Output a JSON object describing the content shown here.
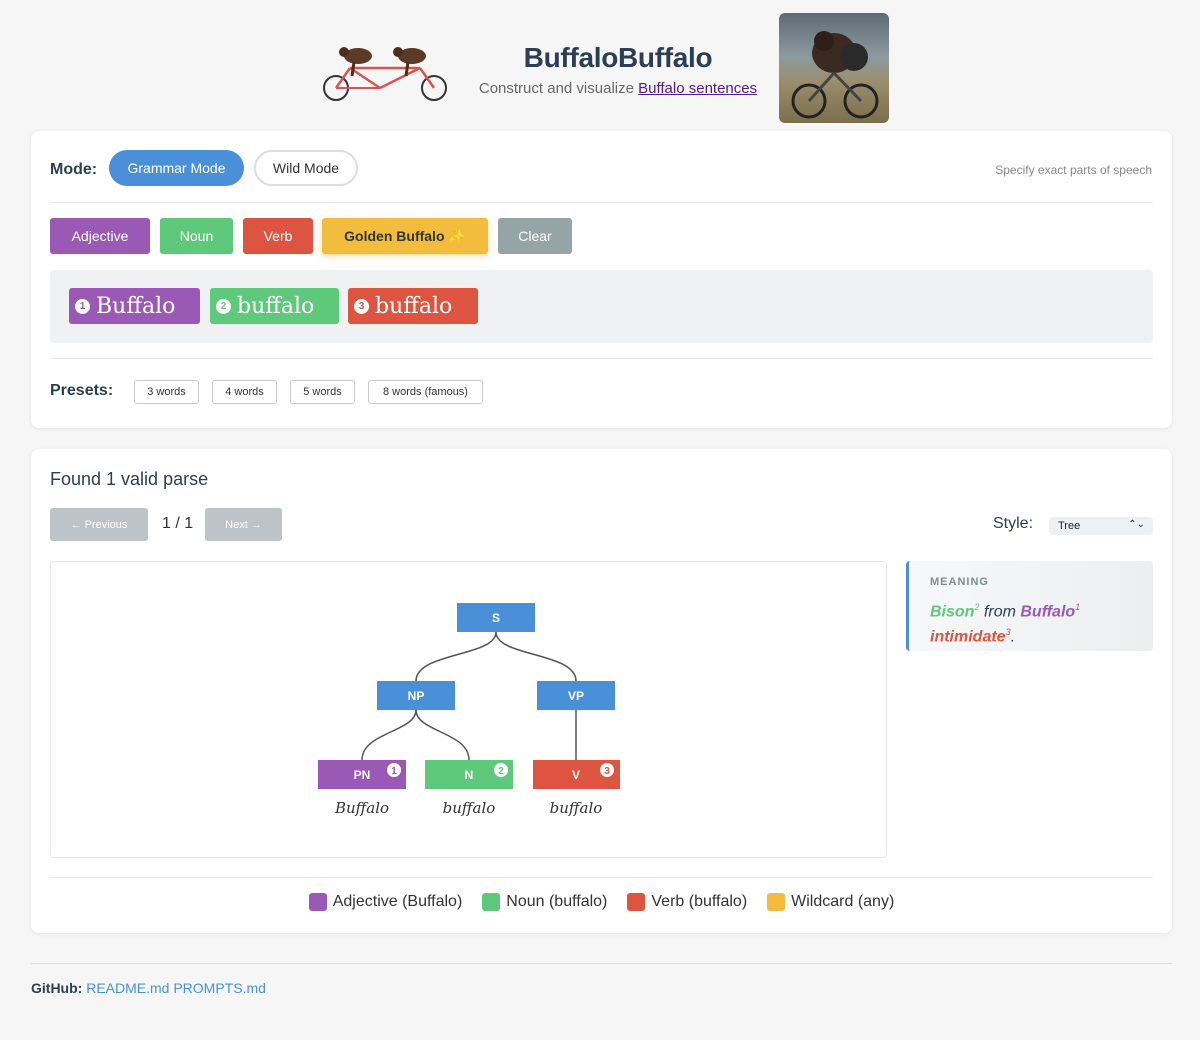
{
  "header": {
    "title": "BuffaloBuffalo",
    "subtitle_prefix": "Construct and visualize ",
    "subtitle_link": "Buffalo sentences",
    "logo_icon": "tandem-bison-bicycle-icon",
    "photo": "bison-riding-bicycle-photo"
  },
  "mode": {
    "label": "Mode:",
    "grammar": "Grammar Mode",
    "wild": "Wild Mode",
    "active": "Grammar Mode",
    "hint": "Specify exact parts of speech"
  },
  "word_buttons": {
    "adjective": "Adjective",
    "noun": "Noun",
    "verb": "Verb",
    "golden": "Golden Buffalo ✨",
    "clear": "Clear"
  },
  "sentence": [
    {
      "num": "1",
      "word": "Buffalo",
      "pos": "adjective"
    },
    {
      "num": "2",
      "word": "buffalo",
      "pos": "noun"
    },
    {
      "num": "3",
      "word": "buffalo",
      "pos": "verb"
    }
  ],
  "presets": {
    "label": "Presets:",
    "items": [
      "3 words",
      "4 words",
      "5 words",
      "8 words (famous)"
    ]
  },
  "results": {
    "found": "Found 1 valid parse",
    "prev": "← Previous",
    "next": "Next →",
    "pager": "1 / 1",
    "style_label": "Style:",
    "style_value": "Tree"
  },
  "tree": {
    "root": "S",
    "phrases": [
      "NP",
      "VP"
    ],
    "leaves": [
      {
        "tag": "PN",
        "num": "1",
        "word": "Buffalo",
        "color": "#9b59b6"
      },
      {
        "tag": "N",
        "num": "2",
        "word": "buffalo",
        "color": "#5ec97a"
      },
      {
        "tag": "V",
        "num": "3",
        "word": "buffalo",
        "color": "#dd5440"
      }
    ],
    "node_color": "#4a90d9"
  },
  "meaning": {
    "heading": "MEANING",
    "w1": "Bison",
    "s1": "2",
    "mid": " from ",
    "w2": "Buffalo",
    "s2": "1",
    "w3": "intimidate",
    "s3": "3",
    "end": "."
  },
  "legend": [
    {
      "label": "Adjective (Buffalo)",
      "color": "#9b59b6"
    },
    {
      "label": "Noun (buffalo)",
      "color": "#5ec97a"
    },
    {
      "label": "Verb (buffalo)",
      "color": "#dd5440"
    },
    {
      "label": "Wildcard (any)",
      "color": "#f2bd3c"
    }
  ],
  "footer": {
    "label": "GitHub:",
    "link1": "README.md",
    "link2": "PROMPTS.md"
  },
  "colors": {
    "accent": "#4a90d9",
    "adjective": "#9b59b6",
    "noun": "#5ec97a",
    "verb": "#dd5440",
    "golden": "#f2bd3c",
    "clear": "#95a5a6"
  }
}
